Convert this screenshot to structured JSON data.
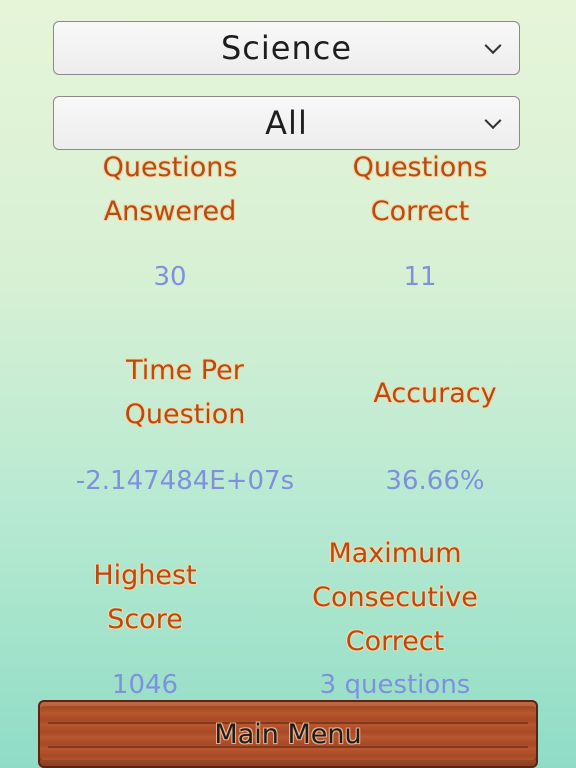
{
  "filters": {
    "subject": "Science",
    "difficulty": "All"
  },
  "stats": {
    "questions_answered": {
      "label_line1": "Questions",
      "label_line2": "Answered",
      "value": "30"
    },
    "questions_correct": {
      "label_line1": "Questions",
      "label_line2": "Correct",
      "value": "11"
    },
    "time_per_question": {
      "label_line1": "Time Per",
      "label_line2": "Question",
      "value": "-2.147484E+07s"
    },
    "accuracy": {
      "label": "Accuracy",
      "value": "36.66%"
    },
    "highest_score": {
      "label_line1": "Highest",
      "label_line2": "Score",
      "value": "1046"
    },
    "max_consecutive": {
      "label_line1": "Maximum",
      "label_line2": "Consecutive",
      "label_line3": "Correct",
      "value": "3 questions"
    }
  },
  "footer": {
    "main_menu_label": "Main Menu"
  },
  "colors": {
    "label": "#b84a14",
    "value": "#7f91dc",
    "plank": "#b5532c"
  }
}
